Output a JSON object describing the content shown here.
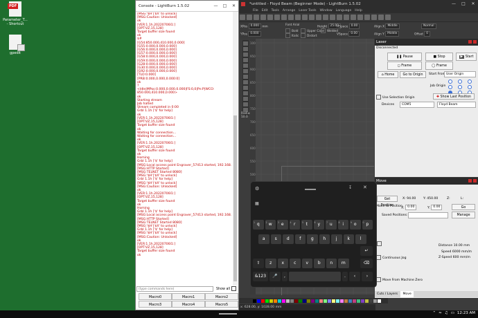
{
  "desktop": {
    "icons": [
      {
        "label": "Parameter_T...\n- Shortcut",
        "badge": "PDF"
      },
      {
        "label": "gpedit"
      }
    ]
  },
  "console": {
    "title": "Console - LightBurn 1.5.02",
    "lines": [
      "[MSG:'$H'|'$X' to unlock]",
      "[MSG:Caution: Unlocked]",
      "ok",
      "[VER:1.1h.20220706I1:]",
      "[OPT:VZ,15,128]",
      "Target buffer size found",
      "ok",
      "$#",
      "[G54:850.000,410.000,0.000]",
      "[G55:0.000,0.000,0.000]",
      "[G56:0.000,0.000,0.000]",
      "[G57:0.000,0.000,0.000]",
      "[G58:0.000,0.000,0.000]",
      "[G59:0.000,0.000,0.000]",
      "[G28:0.000,0.000,0.000]",
      "[G30:0.000,0.000,0.000]",
      "[G92:0.000,0.000,0.000]",
      "[TLO:0.000]",
      "[PRB:0.000,0.000,0.000:0]",
      "ok",
      "?",
      "<Idle|MPos:0.000,0.000,0.000|FS:0,0|Pn:P|WCO:",
      "850.000,410.000,0.000>",
      "ok",
      "Starting stream",
      "Job halted",
      "Stream completed in 0:00",
      "Grbl 1.1h ['$' for help]",
      "ok",
      "[VER:1.1h.20220706I1:]",
      "[OPT:VZ,15,128]",
      "Target buffer size found",
      "ok",
      "Waiting for connection...",
      "Waiting for connection...",
      "ok",
      "[VER:1.1h.20220706I1:]",
      "[OPT:VZ,15,128]",
      "Target buffer size found",
      "ok",
      "Homing",
      "Grbl 1.1h ['$' for help]",
      "[MSG:Local access point Engraver_57413 started, 192.168.4.1]",
      "[MSG:HTTP Started]",
      "[MSG:TELNET Started 8080]",
      "[MSG:'$H'|'$X' to unlock]",
      "Grbl 1.1h ['$' for help]",
      "[MSG:'$H'|'$X' to unlock]",
      "[MSG:Caution: Unlocked]",
      "ok",
      "[VER:1.1h.20220706I1:]",
      "[OPT:VZ,15,128]",
      "Target buffer size found",
      "ok",
      "Homing",
      "Grbl 1.1h ['$' for help]",
      "[MSG:Local access point Engraver_57413 started, 192.168.4.1]",
      "[MSG:HTTP Started]",
      "[MSG:TELNET Started 8080]",
      "[MSG:'$H'|'$X' to unlock]",
      "Grbl 1.1h ['$' for help]",
      "[MSG:'$H'|'$X' to unlock]",
      "[MSG:Caution: Unlocked]",
      "ok",
      "[VER:1.1h.20220706I1:]",
      "[OPT:VZ,15,128]",
      "Target buffer size found",
      "ok"
    ],
    "command_placeholder": "(type commands here)",
    "show_all": "Show all",
    "macros": [
      "Macro0",
      "Macro1",
      "Macro2",
      "Macro3",
      "Macro4",
      "Macro5"
    ]
  },
  "lightburn": {
    "title": "*untitled - Floyd Beam (Beginner Mode) - LightBurn 1.5.02",
    "menu": [
      "File",
      "Edit",
      "Tools",
      "Arrange",
      "Laser Tools",
      "Window",
      "Language",
      "Help"
    ],
    "props": {
      "xpos_label": "XPos",
      "xpos": "0.000",
      "ypos_label": "YPos",
      "ypos": "0.000",
      "unit": "mm",
      "font": "Font Arial",
      "height_label": "Height",
      "height": "25.00",
      "hspace_label": "HSpace",
      "hspace": "0.00",
      "vspace_label": "VSpace",
      "vspace": "0.00",
      "bold": "Bold",
      "upper": "Upper Case",
      "welded": "Welded",
      "italic": "Italic",
      "distort": "Distort",
      "alignx_label": "Align X",
      "alignx": "Middle",
      "aligny_label": "Align Y",
      "aligny": "Middle",
      "normal": "Normal",
      "offset_label": "Offset",
      "offset": "0"
    },
    "radius_label": "Radius:",
    "radius_value": "10.0",
    "ruler": [
      "1000",
      "950",
      "900",
      "850",
      "800",
      "750",
      "700",
      "650",
      "600",
      "550",
      "500",
      "450",
      "400",
      "350",
      "300",
      "250",
      "200",
      "150",
      "100"
    ],
    "palette": [
      "#000000",
      "#0000ff",
      "#ff0000",
      "#00e000",
      "#d0d000",
      "#ff8000",
      "#00d0d0",
      "#ff00ff",
      "#c0c0c0",
      "#808080",
      "#800000",
      "#008000",
      "#000080",
      "#808000",
      "#800080",
      "#008080",
      "#ff8080",
      "#80ff80",
      "#8080ff",
      "#ffff80",
      "#80ffff",
      "#ff80ff",
      "#c08040",
      "#4080c0",
      "#c04080",
      "#40c080",
      "#8040c0",
      "#c0c040",
      "#404040",
      "#a0a0a0",
      "#ffffff"
    ],
    "status": "x: 628.00, y: 1028.00 mm"
  },
  "laser": {
    "title": "Laser",
    "status": "Disconnected",
    "pause": "Pause",
    "stop": "Stop",
    "start": "Start",
    "frame1": "Frame",
    "frame2": "Frame",
    "home": "Home",
    "go_origin": "Go to Origin",
    "start_from_label": "Start From:",
    "start_from": "User Origin",
    "job_origin": "Job Origin",
    "show_last": "Show Last Position",
    "use_selection": "Use Selection Origin",
    "devices_label": "Devices",
    "port": "COM5",
    "device": "Floyd Beam"
  },
  "move": {
    "title": "Move",
    "get_position": "Get Position",
    "x_label": "X:",
    "x": "94.00",
    "y_label": "Y:",
    "y": "450.00",
    "z_label": "Z:",
    "l_label": "L:",
    "move_to_label": "Move to Position",
    "mx_label": "X:",
    "mx": "0.00",
    "my_label": "Y:",
    "my": "0.00",
    "go": "Go",
    "saved_label": "Saved Positions:",
    "manage": "Manage",
    "distance_label": "Distance",
    "distance": "10.00",
    "distance_unit": "mm",
    "speed_label": "Speed",
    "speed": "6000",
    "speed_unit": "mm/m",
    "zspeed_label": "Z-Speed",
    "zspeed": "600",
    "zspeed_unit": "mm/m",
    "continuous_jog": "Continuous Jog",
    "move_from_zero": "Move From Machine Zero",
    "tabs": [
      "Cuts / Layers",
      "Move"
    ]
  },
  "keyboard": {
    "row1": [
      "q",
      "w",
      "e",
      "r",
      "t",
      "y",
      "u",
      "i",
      "o",
      "p"
    ],
    "row1_nums": [
      "1",
      "2",
      "3",
      "4",
      "5",
      "6",
      "7",
      "8",
      "9",
      "0"
    ],
    "row2": [
      "a",
      "s",
      "d",
      "f",
      "g",
      "h",
      "j",
      "k",
      "l"
    ],
    "row3": [
      "z",
      "x",
      "c",
      "v",
      "b",
      "n",
      "m"
    ],
    "sym": "&123"
  },
  "taskbar": {
    "time": "12:23 AM"
  }
}
